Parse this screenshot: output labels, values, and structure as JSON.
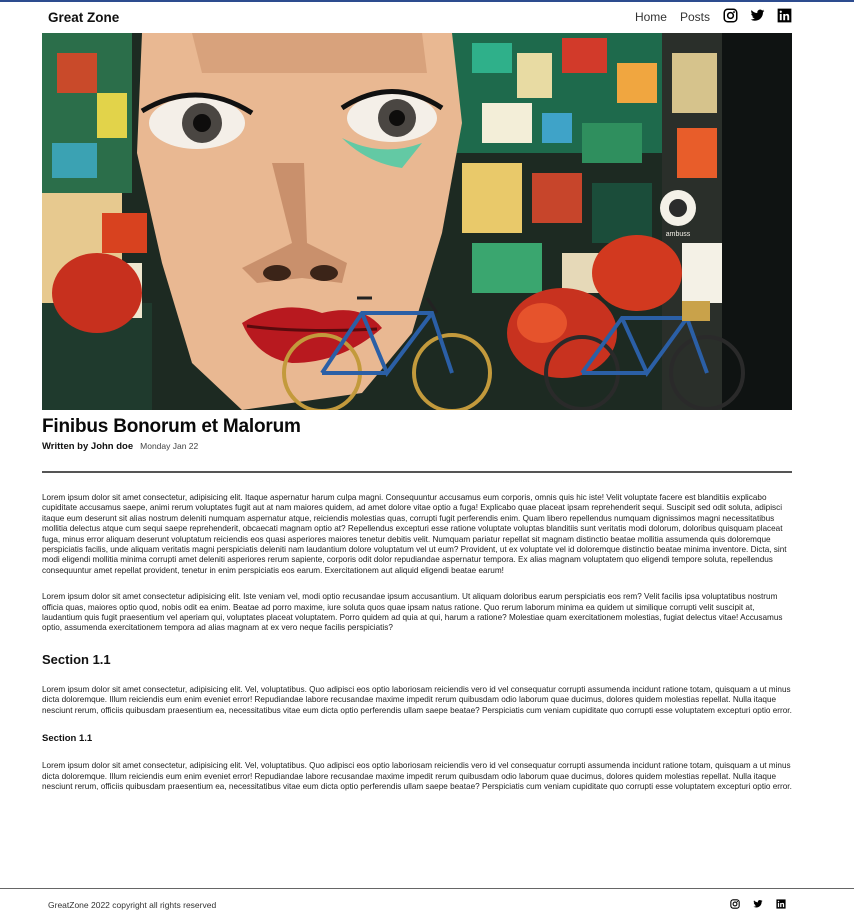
{
  "nav": {
    "brand": "Great Zone",
    "links": [
      "Home",
      "Posts"
    ],
    "icons": [
      "instagram-icon",
      "twitter-icon",
      "linkedin-icon"
    ]
  },
  "hero": {
    "image": "graffiti-mural-woman-face-with-bicycles",
    "wall_text": "ambuss"
  },
  "post": {
    "title": "Finibus Bonorum et Malorum",
    "author": "Written by John doe",
    "date": "Monday Jan 22"
  },
  "content": {
    "p1": "Lorem ipsum dolor sit amet consectetur, adipisicing elit. Itaque aspernatur harum culpa magni. Consequuntur accusamus eum corporis, omnis quis hic iste! Velit voluptate facere est blanditiis explicabo cupiditate accusamus saepe, animi rerum voluptates fugit aut at nam maiores quidem, ad amet dolore vitae optio a fuga! Explicabo quae placeat ipsam reprehenderit sequi. Suscipit sed odit soluta, adipisci itaque eum deserunt sit alias nostrum deleniti numquam aspernatur atque, reiciendis molestias quas, corrupti fugit perferendis enim. Quam libero repellendus numquam dignissimos magni necessitatibus mollitia delectus atque cum sequi saepe reprehenderit, obcaecati magnam optio at? Repellendus excepturi esse ratione voluptate voluptas blanditiis sunt veritatis modi dolorum, doloribus quisquam placeat fuga, minus error aliquam deserunt voluptatum reiciendis eos quasi asperiores maiores tenetur debitis velit. Numquam pariatur repellat sit magnam distinctio beatae mollitia assumenda quis doloremque perspiciatis facilis, unde aliquam veritatis magni perspiciatis deleniti nam laudantium dolore voluptatum vel ut eum? Provident, ut ex voluptate vel id doloremque distinctio beatae minima inventore. Dicta, sint modi eligendi mollitia minima corrupti amet deleniti asperiores rerum sapiente, corporis odit dolor repudiandae aspernatur tempora. Ex alias magnam voluptatem quo eligendi tempore soluta, repellendus consequuntur amet repellat provident, tenetur in enim perspiciatis eos earum. Exercitationem aut aliquid eligendi beatae earum!",
    "p2": "Lorem ipsum dolor sit amet consectetur adipisicing elit. Iste veniam vel, modi optio recusandae ipsum accusantium. Ut aliquam doloribus earum perspiciatis eos rem? Velit facilis ipsa voluptatibus nostrum officia quas, maiores optio quod, nobis odit ea enim. Beatae ad porro maxime, iure soluta quos quae ipsam natus ratione. Quo rerum laborum minima ea quidem ut similique corrupti velit suscipit at, laudantium quis fugit praesentium vel aperiam qui, voluptates placeat voluptatem. Porro quidem ad quia at qui, harum a ratione? Molestiae quam exercitationem molestias, fugiat delectus vitae! Accusamus optio, assumenda exercitationem tempora ad alias magnam at ex vero neque facilis perspiciatis?",
    "section_heading": "Section 1.1",
    "p3": "Lorem ipsum dolor sit amet consectetur, adipisicing elit. Vel, voluptatibus. Quo adipisci eos optio laboriosam reiciendis vero id vel consequatur corrupti assumenda incidunt ratione totam, quisquam a ut minus dicta doloremque. Illum reiciendis eum enim eveniet error! Repudiandae labore recusandae maxime impedit rerum quibusdam odio laborum quae ducimus, dolores quidem molestias repellat. Nulla itaque nesciunt rerum, officiis quibusdam praesentium ea, necessitatibus vitae eum dicta optio perferendis ullam saepe beatae? Perspiciatis cum veniam cupiditate quo corrupti esse voluptatem excepturi optio error.",
    "subsection_heading": "Section 1.1",
    "p4": "Lorem ipsum dolor sit amet consectetur, adipisicing elit. Vel, voluptatibus. Quo adipisci eos optio laboriosam reiciendis vero id vel consequatur corrupti assumenda incidunt ratione totam, quisquam a ut minus dicta doloremque. Illum reiciendis eum enim eveniet error! Repudiandae labore recusandae maxime impedit rerum quibusdam odio laborum quae ducimus, dolores quidem molestias repellat. Nulla itaque nesciunt rerum, officiis quibusdam praesentium ea, necessitatibus vitae eum dicta optio perferendis ullam saepe beatae? Perspiciatis cum veniam cupiditate quo corrupti esse voluptatem excepturi optio error."
  },
  "footer": {
    "copyright": "GreatZone 2022 copyright all rights reserved",
    "icons": [
      "instagram-icon",
      "twitter-icon",
      "linkedin-icon"
    ]
  },
  "colors": {
    "top_accent": "#2d4c8f",
    "text": "#111111",
    "rule": "#555555"
  }
}
